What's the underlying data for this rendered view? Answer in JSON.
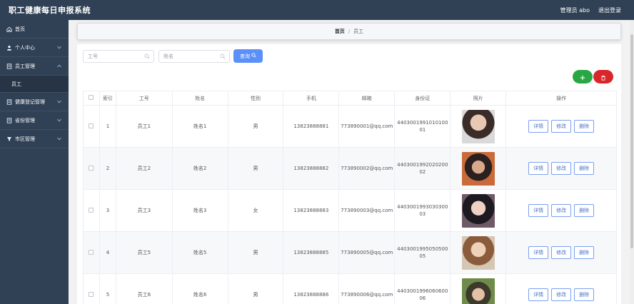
{
  "app": {
    "title": "职工健康每日申报系统"
  },
  "header": {
    "user": "管理员 abo",
    "logout": "退出登录"
  },
  "sidebar": {
    "items": [
      {
        "label": "首页",
        "icon": "home-icon"
      },
      {
        "label": "个人中心",
        "icon": "user-icon"
      },
      {
        "label": "员工管理",
        "icon": "doc-icon",
        "submenu": "员工"
      },
      {
        "label": "健康登记管理",
        "icon": "doc-icon"
      },
      {
        "label": "省份管理",
        "icon": "doc-icon"
      },
      {
        "label": "市区管理",
        "icon": "funnel-icon"
      }
    ]
  },
  "breadcrumb": {
    "home": "首页",
    "current": "员工"
  },
  "search": {
    "employee_no_placeholder": "工号",
    "name_placeholder": "姓名",
    "query_label": "查询"
  },
  "table": {
    "headers": [
      "索引",
      "工号",
      "姓名",
      "性别",
      "手机",
      "邮箱",
      "身份证",
      "照片",
      "操作"
    ],
    "actions": {
      "detail": "详情",
      "edit": "修改",
      "delete": "删除"
    },
    "rows": [
      {
        "index": "1",
        "emp_no": "员工1",
        "name": "姓名1",
        "gender": "男",
        "phone": "13823888881",
        "email": "773890001@qq.com",
        "id_card": "440300199101010001"
      },
      {
        "index": "2",
        "emp_no": "员工2",
        "name": "姓名2",
        "gender": "男",
        "phone": "13823888882",
        "email": "773890002@qq.com",
        "id_card": "440300199202020002"
      },
      {
        "index": "3",
        "emp_no": "员工3",
        "name": "姓名3",
        "gender": "女",
        "phone": "13823888883",
        "email": "773890003@qq.com",
        "id_card": "440300199303030003"
      },
      {
        "index": "4",
        "emp_no": "员工5",
        "name": "姓名5",
        "gender": "男",
        "phone": "13823888885",
        "email": "773890005@qq.com",
        "id_card": "440300199505050005"
      },
      {
        "index": "5",
        "emp_no": "员工6",
        "name": "姓名6",
        "gender": "男",
        "phone": "13823888886",
        "email": "773890006@qq.com",
        "id_card": "440300199606060006"
      }
    ]
  },
  "colors": {
    "sidebar": "#304156",
    "primary": "#5b8ff9",
    "add": "#29a745",
    "delete": "#d9262a"
  }
}
